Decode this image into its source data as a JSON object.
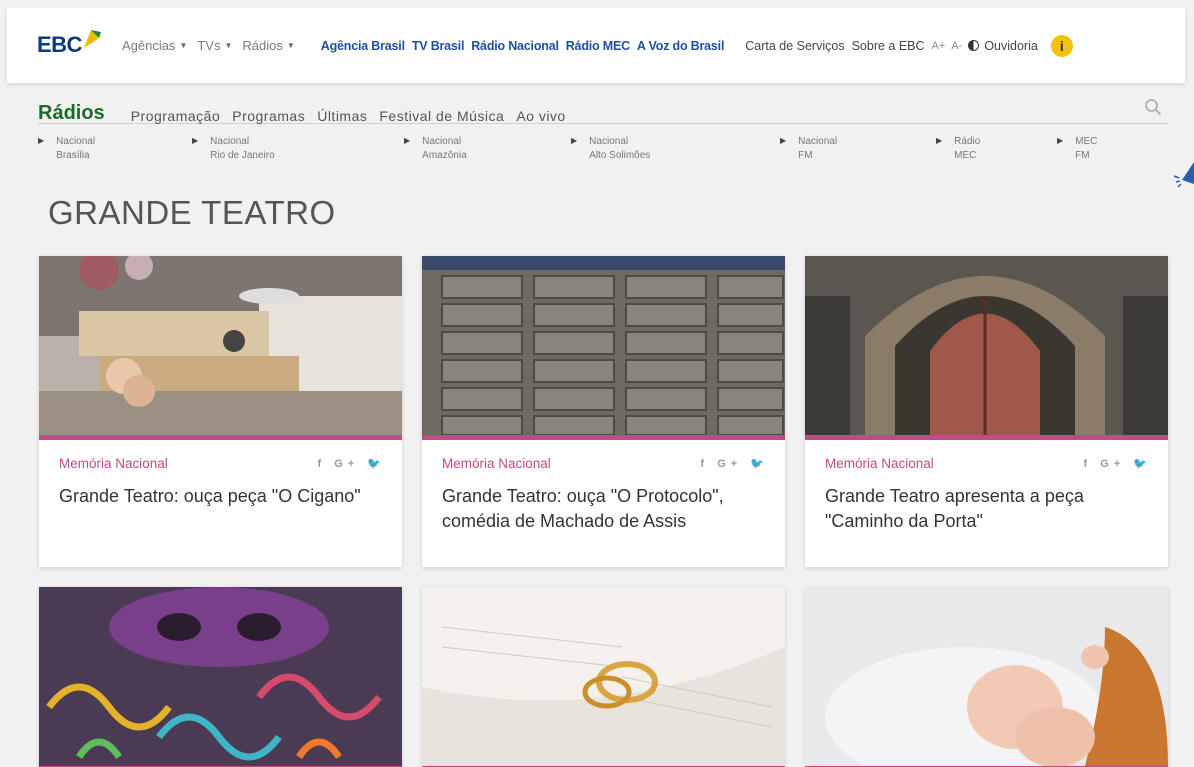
{
  "topbar": {
    "logo": "EBC",
    "dropdowns": [
      "Agências",
      "TVs",
      "Rádios"
    ],
    "channels": [
      "Agência Brasil",
      "TV Brasil",
      "Rádio Nacional",
      "Rádio MEC",
      "A Voz do Brasil"
    ],
    "links": [
      "Carta de Serviços",
      "Sobre a EBC"
    ],
    "font_increase": "A+",
    "font_decrease": "A-",
    "ombudsman": "Ouvidoria"
  },
  "section": {
    "title": "Rádios",
    "menu": [
      "Programação",
      "Programas",
      "Últimas",
      "Festival de Música",
      "Ao vivo"
    ]
  },
  "stations": [
    {
      "line1": "Nacional",
      "line2": "Brasília"
    },
    {
      "line1": "Nacional",
      "line2": "Rio de Janeiro"
    },
    {
      "line1": "Nacional",
      "line2": "Amazônia"
    },
    {
      "line1": "Nacional",
      "line2": "Alto Solimões"
    },
    {
      "line1": "Nacional",
      "line2": "FM"
    },
    {
      "line1": "Rádio",
      "line2": "MEC"
    },
    {
      "line1": "MEC",
      "line2": "FM"
    }
  ],
  "page_title": "GRANDE TEATRO",
  "share_labels": "f G+ ",
  "cards": [
    {
      "category": "Memória Nacional",
      "headline": "Grande Teatro: ouça peça \"O Cigano\""
    },
    {
      "category": "Memória Nacional",
      "headline": "Grande Teatro: ouça \"O Protocolo\", comédia de Machado de Assis"
    },
    {
      "category": "Memória Nacional",
      "headline": "Grande Teatro apresenta a peça \"Caminho da Porta\""
    }
  ],
  "colors": {
    "accent": "#c24b85",
    "brand_blue": "#1f4f9f",
    "section_green": "#1d6a2a"
  }
}
